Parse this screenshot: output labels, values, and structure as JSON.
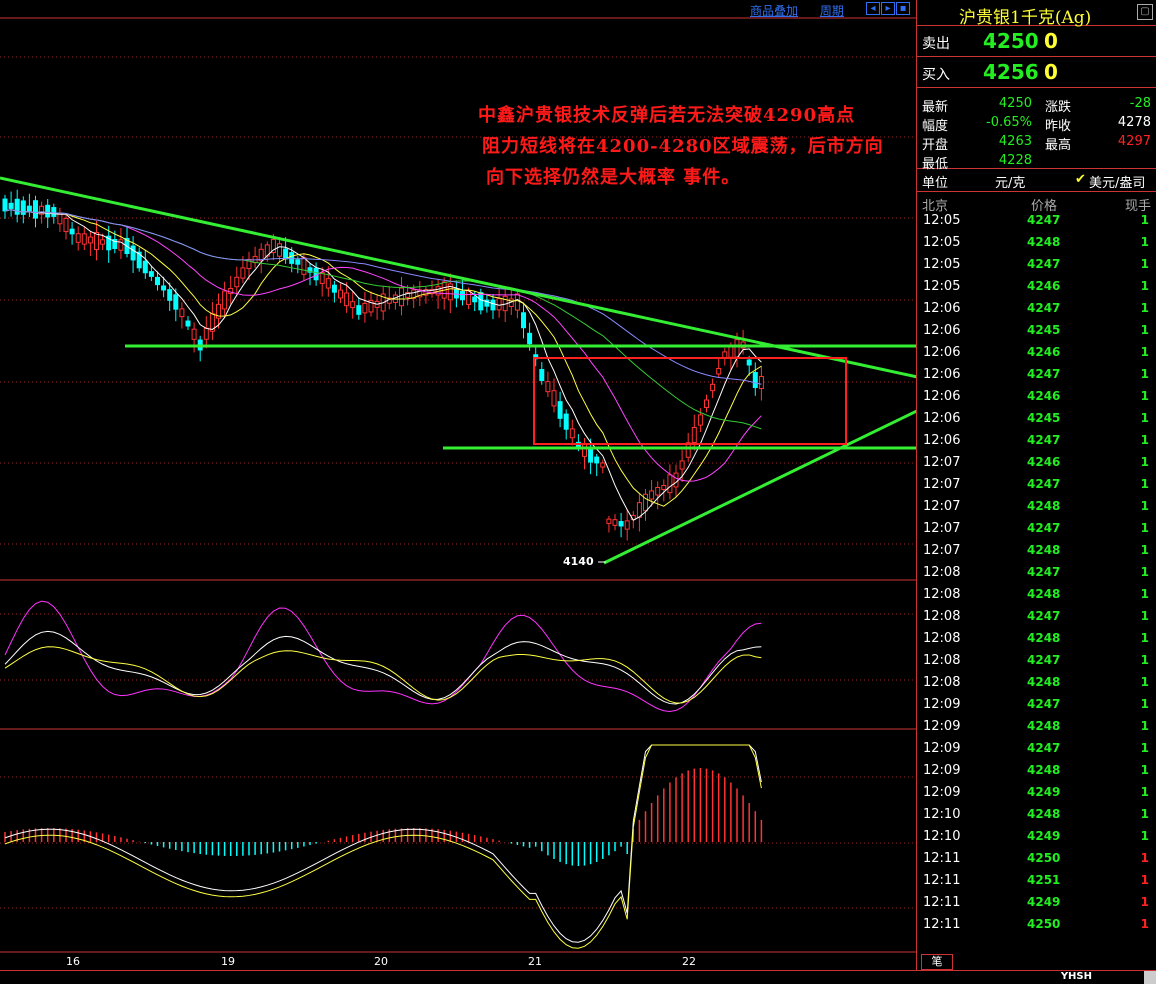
{
  "toolbar": {
    "overlay_label": "商品叠加",
    "period_label": "周期"
  },
  "annotation": {
    "line1": "中鑫沪贵银技术反弹后若无法突破4290高点",
    "line2": "阻力短线将在4200-4280区域震荡，后市方向",
    "line3": "向下选择仍然是大概率 事件。"
  },
  "chart_data": {
    "type": "candlestick",
    "x_ticks": [
      "16",
      "19",
      "20",
      "21",
      "22"
    ],
    "low_marker": "4140",
    "colors": {
      "up": "#ff3333",
      "down": "#00ffff",
      "trendline": "#33ee33",
      "box": "#ff2020"
    }
  },
  "panel": {
    "title": "沪贵银1千克(Ag)",
    "sell": {
      "label": "卖出",
      "price": "4250",
      "qty": "0"
    },
    "buy": {
      "label": "买入",
      "price": "4256",
      "qty": "0"
    },
    "stats": [
      {
        "k1": "最新",
        "v1": "4250",
        "c1": "#22ee22",
        "k2": "涨跌",
        "v2": "-28",
        "c2": "#22ee22"
      },
      {
        "k1": "幅度",
        "v1": "-0.65%",
        "c1": "#22ee22",
        "k2": "昨收",
        "v2": "4278",
        "c2": "#ffffff"
      },
      {
        "k1": "开盘",
        "v1": "4263",
        "c1": "#22ee22",
        "k2": "最高",
        "v2": "4297",
        "c2": "#ff2222"
      },
      {
        "k1": "最低",
        "v1": "4228",
        "c1": "#22ee22",
        "k2": "",
        "v2": "",
        "c2": "#ffffff"
      }
    ],
    "unit_label": "单位",
    "unit_value": "元/克",
    "unit_alt": "美元/盎司",
    "head": {
      "time": "北京",
      "price": "价格",
      "qty": "现手"
    },
    "trades": [
      {
        "time": "12:05",
        "price": "4247",
        "qty": "1"
      },
      {
        "time": "12:05",
        "price": "4248",
        "qty": "1"
      },
      {
        "time": "12:05",
        "price": "4247",
        "qty": "1"
      },
      {
        "time": "12:05",
        "price": "4246",
        "qty": "1"
      },
      {
        "time": "12:06",
        "price": "4247",
        "qty": "1"
      },
      {
        "time": "12:06",
        "price": "4245",
        "qty": "1"
      },
      {
        "time": "12:06",
        "price": "4246",
        "qty": "1"
      },
      {
        "time": "12:06",
        "price": "4247",
        "qty": "1"
      },
      {
        "time": "12:06",
        "price": "4246",
        "qty": "1"
      },
      {
        "time": "12:06",
        "price": "4245",
        "qty": "1"
      },
      {
        "time": "12:06",
        "price": "4247",
        "qty": "1"
      },
      {
        "time": "12:07",
        "price": "4246",
        "qty": "1"
      },
      {
        "time": "12:07",
        "price": "4247",
        "qty": "1"
      },
      {
        "time": "12:07",
        "price": "4248",
        "qty": "1"
      },
      {
        "time": "12:07",
        "price": "4247",
        "qty": "1"
      },
      {
        "time": "12:07",
        "price": "4248",
        "qty": "1"
      },
      {
        "time": "12:08",
        "price": "4247",
        "qty": "1"
      },
      {
        "time": "12:08",
        "price": "4248",
        "qty": "1"
      },
      {
        "time": "12:08",
        "price": "4247",
        "qty": "1"
      },
      {
        "time": "12:08",
        "price": "4248",
        "qty": "1"
      },
      {
        "time": "12:08",
        "price": "4247",
        "qty": "1"
      },
      {
        "time": "12:08",
        "price": "4248",
        "qty": "1"
      },
      {
        "time": "12:09",
        "price": "4247",
        "qty": "1"
      },
      {
        "time": "12:09",
        "price": "4248",
        "qty": "1"
      },
      {
        "time": "12:09",
        "price": "4247",
        "qty": "1"
      },
      {
        "time": "12:09",
        "price": "4248",
        "qty": "1"
      },
      {
        "time": "12:09",
        "price": "4249",
        "qty": "1"
      },
      {
        "time": "12:10",
        "price": "4248",
        "qty": "1"
      },
      {
        "time": "12:10",
        "price": "4249",
        "qty": "1"
      },
      {
        "time": "12:11",
        "price": "4250",
        "qty": "1",
        "red": true
      },
      {
        "time": "12:11",
        "price": "4251",
        "qty": "1",
        "red": true
      },
      {
        "time": "12:11",
        "price": "4249",
        "qty": "1",
        "red": true
      },
      {
        "time": "12:11",
        "price": "4250",
        "qty": "1",
        "red": true
      }
    ],
    "tab_label": "笔"
  },
  "status": {
    "text": "YHSH"
  }
}
